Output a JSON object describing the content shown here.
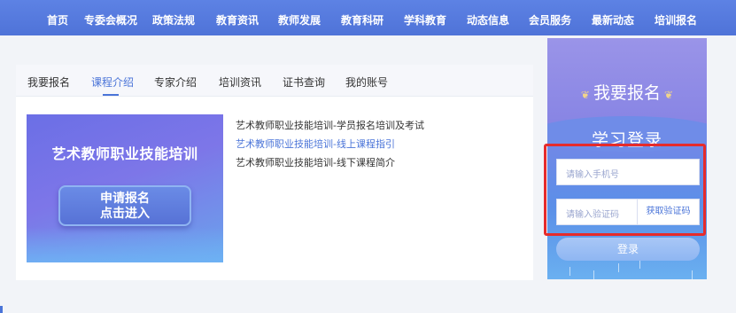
{
  "nav": {
    "items": [
      "首页",
      "专委会概况",
      "政策法规",
      "教育资讯",
      "教师发展",
      "教育科研",
      "学科教育",
      "动态信息",
      "会员服务",
      "最新动态",
      "培训报名"
    ]
  },
  "tabs": [
    "我要报名",
    "课程介绍",
    "专家介绍",
    "培训资讯",
    "证书查询",
    "我的账号"
  ],
  "banner": {
    "title": "艺术教师职业技能培训",
    "button_line1": "申请报名",
    "button_line2": "点击进入"
  },
  "courses": [
    "艺术教师职业技能培训-学员报名培训及考试",
    "艺术教师职业技能培训-线上课程指引",
    "艺术教师职业技能培训-线下课程简介"
  ],
  "side": {
    "title": "我要报名",
    "subtitle": "学习登录",
    "phone_placeholder": "请输入手机号",
    "code_placeholder": "请输入验证码",
    "code_button": "获取验证码",
    "login_button": "登录"
  },
  "colors": {
    "nav_bg": "#5676dc",
    "accent": "#4a74d8",
    "highlight_border": "#e62b2b"
  },
  "icons": {
    "wheat_left": "wheat-icon",
    "wheat_right": "wheat-icon"
  }
}
